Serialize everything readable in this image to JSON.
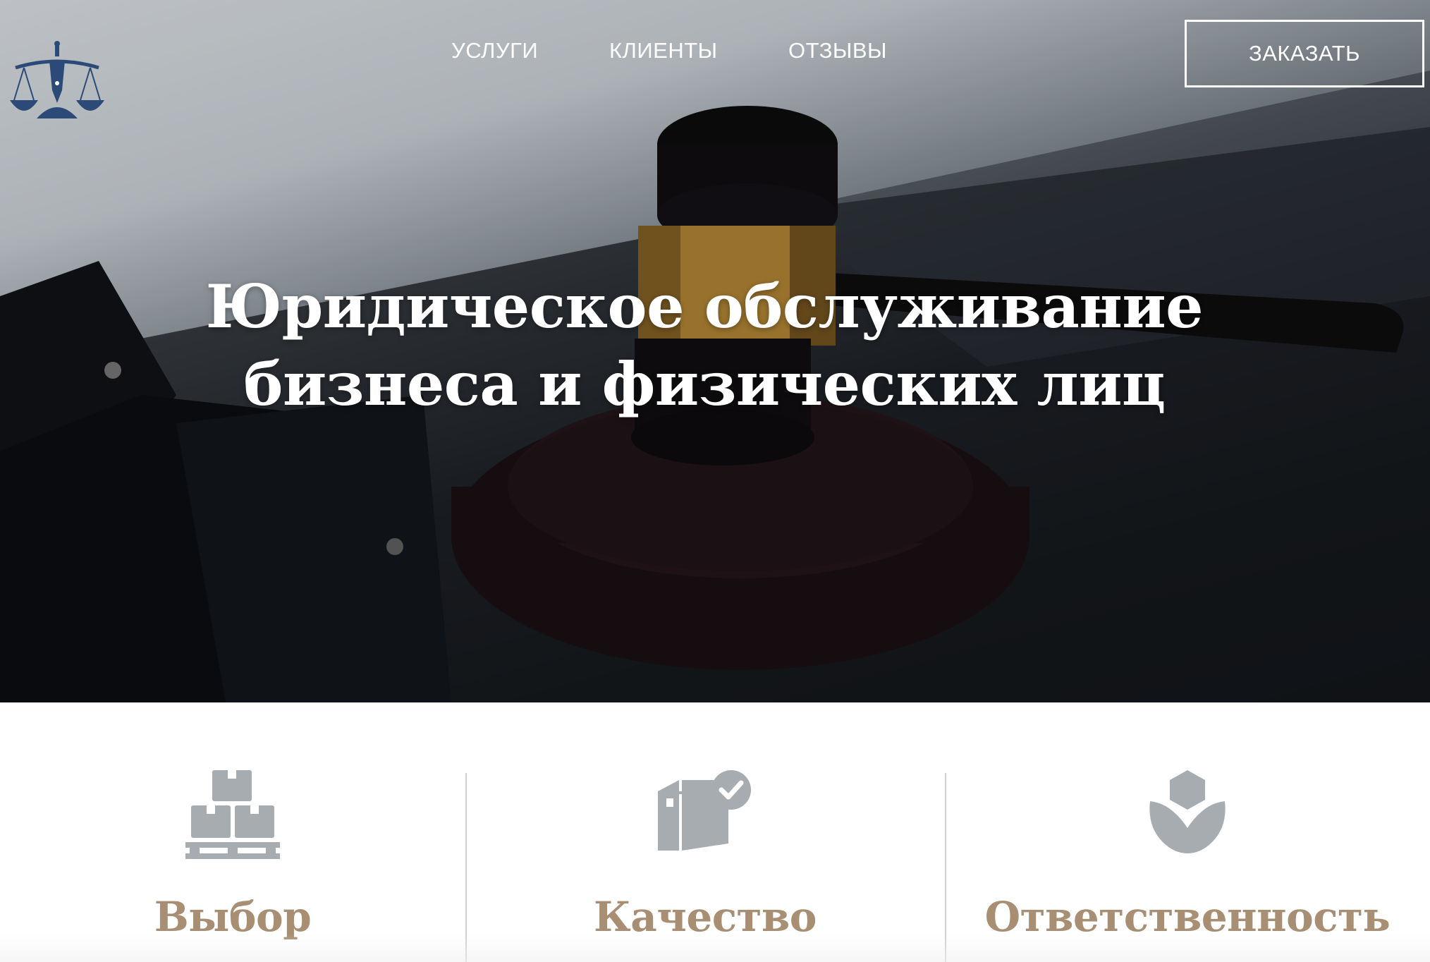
{
  "header": {
    "logo_icon": "scales-of-justice-pen-icon",
    "nav": [
      {
        "label": "УСЛУГИ"
      },
      {
        "label": "КЛИЕНТЫ"
      },
      {
        "label": "ОТЗЫВЫ"
      }
    ],
    "cta_label": "ЗАКАЗАТЬ"
  },
  "hero": {
    "title_line1": "Юридическое обслуживание",
    "title_line2": "бизнеса и физических лиц",
    "background": "gavel-on-desk-photo"
  },
  "features": [
    {
      "title": "Выбор",
      "icon": "boxes-on-pallet-icon"
    },
    {
      "title": "Качество",
      "icon": "box-checkmark-icon"
    },
    {
      "title": "Ответственность",
      "icon": "hand-holding-hexagon-icon"
    }
  ],
  "colors": {
    "accent": "#a88e72",
    "logo": "#2c4a78",
    "icon_gray": "#a7acb0",
    "hero_text": "#ffffff"
  }
}
